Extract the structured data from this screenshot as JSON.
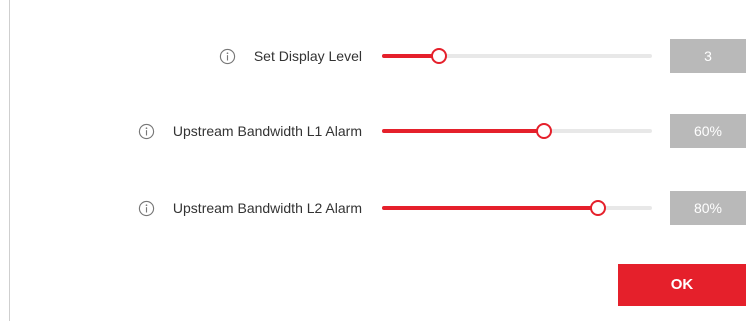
{
  "settings": [
    {
      "label": "Set Display Level",
      "value_text": "3",
      "level_fraction": 0.21,
      "info_icon": "info-circle-icon"
    },
    {
      "label": "Upstream Bandwidth L1 Alarm",
      "value_text": "60%",
      "level_fraction": 0.6,
      "info_icon": "info-circle-icon"
    },
    {
      "label": "Upstream Bandwidth L2 Alarm",
      "value_text": "80%",
      "level_fraction": 0.8,
      "info_icon": "info-circle-icon"
    }
  ],
  "ok_button": {
    "label": "OK"
  },
  "colors": {
    "accent": "#e5202b",
    "track": "#e8e8e8",
    "value_box": "#b9b9b9",
    "label_text": "#333333"
  }
}
